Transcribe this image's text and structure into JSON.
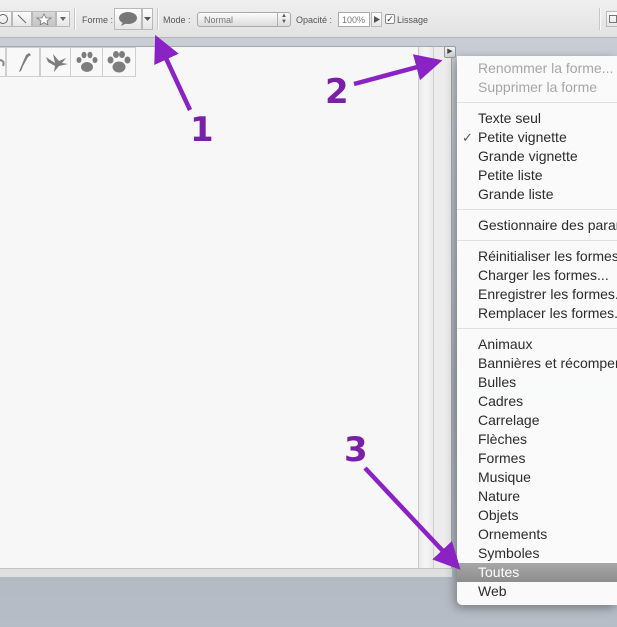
{
  "options_bar": {
    "forme_label": "Forme :",
    "mode_label": "Mode :",
    "mode_value": "Normal",
    "opacite_label": "Opacité :",
    "opacite_value": "100%",
    "lissage_label": "Lissage",
    "lissage_checked": true
  },
  "shapes_panel": {
    "thumbnails": [
      "bird-icon",
      "dove-icon",
      "paw-print-icon",
      "paw-print-icon"
    ]
  },
  "menu": {
    "groups": [
      [
        {
          "label": "Renommer la forme...",
          "disabled": true
        },
        {
          "label": "Supprimer la forme",
          "disabled": true
        }
      ],
      [
        {
          "label": "Texte seul"
        },
        {
          "label": "Petite vignette",
          "checked": true
        },
        {
          "label": "Grande vignette"
        },
        {
          "label": "Petite liste"
        },
        {
          "label": "Grande liste"
        }
      ],
      [
        {
          "label": "Gestionnaire des paramètres prédéfinis..."
        }
      ],
      [
        {
          "label": "Réinitialiser les formes..."
        },
        {
          "label": "Charger les formes..."
        },
        {
          "label": "Enregistrer les formes..."
        },
        {
          "label": "Remplacer les formes..."
        }
      ],
      [
        {
          "label": "Animaux"
        },
        {
          "label": "Bannières et récompenses"
        },
        {
          "label": "Bulles"
        },
        {
          "label": "Cadres"
        },
        {
          "label": "Carrelage"
        },
        {
          "label": "Flèches"
        },
        {
          "label": "Formes"
        },
        {
          "label": "Musique"
        },
        {
          "label": "Nature"
        },
        {
          "label": "Objets"
        },
        {
          "label": "Ornements"
        },
        {
          "label": "Symboles"
        },
        {
          "label": "Toutes",
          "highlighted": true
        },
        {
          "label": "Web"
        }
      ]
    ]
  },
  "annotations": {
    "labels": [
      "1",
      "2",
      "3"
    ],
    "color": "#7a1fa8"
  }
}
